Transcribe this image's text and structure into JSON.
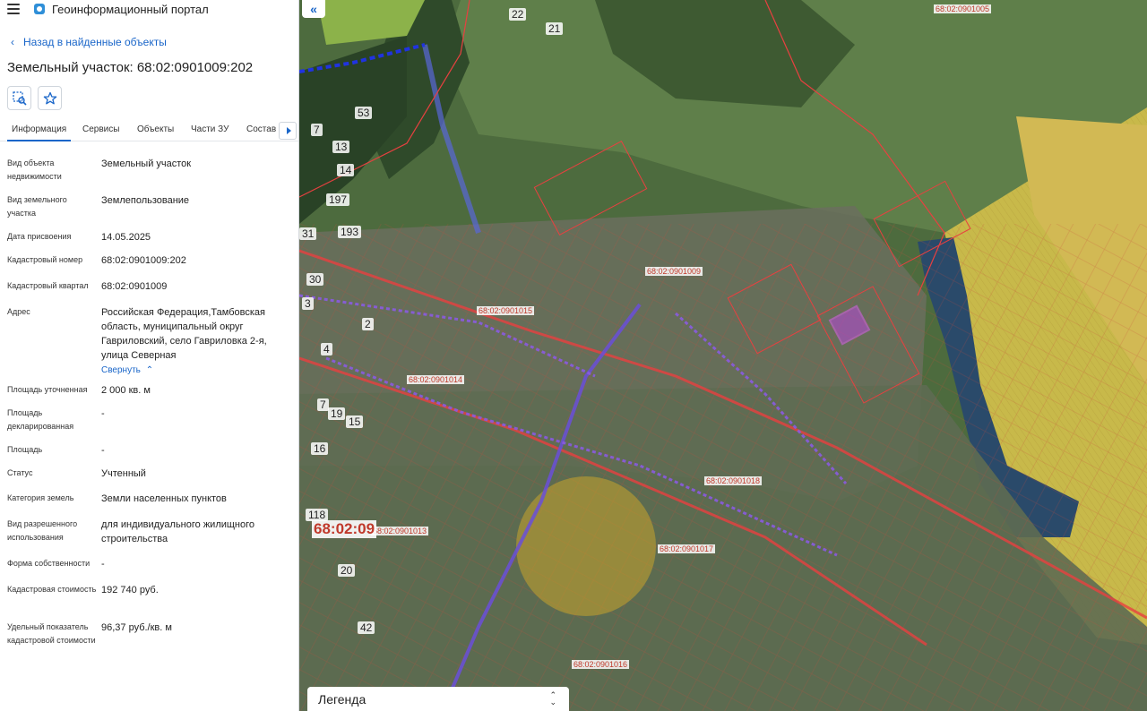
{
  "app": {
    "title": "Геоинформационный портал"
  },
  "nav": {
    "back_label": "Назад в найденные объекты"
  },
  "object": {
    "title": "Земельный участок: 68:02:0901009:202"
  },
  "tabs": [
    {
      "label": "Информация",
      "active": true
    },
    {
      "label": "Сервисы"
    },
    {
      "label": "Объекты"
    },
    {
      "label": "Части ЗУ"
    },
    {
      "label": "Состав"
    }
  ],
  "info": [
    {
      "label": "Вид объекта недвижимости",
      "value": "Земельный участок"
    },
    {
      "label": "Вид земельного участка",
      "value": "Землепользование"
    },
    {
      "label": "Дата присвоения",
      "value": "14.05.2025"
    },
    {
      "label": "Кадастровый номер",
      "value": "68:02:0901009:202"
    },
    {
      "label": "Кадастровый квартал",
      "value": "68:02:0901009"
    },
    {
      "label": "Адрес",
      "value": "Российская Федерация,Тамбовская область, муниципальный округ Гавриловский, село Гавриловка 2-я, улица Северная"
    },
    {
      "label": "Площадь уточненная",
      "value": "2 000 кв. м"
    },
    {
      "label": "Площадь декларированная",
      "value": "-"
    },
    {
      "label": "Площадь",
      "value": "-"
    },
    {
      "label": "Статус",
      "value": "Учтенный"
    },
    {
      "label": "Категория земель",
      "value": "Земли населенных пунктов"
    },
    {
      "label": "Вид разрешенного использования",
      "value": "для индивидуального жилищного строительства"
    },
    {
      "label": "Форма собственности",
      "value": "-"
    },
    {
      "label": "Кадастровая стоимость",
      "value": "192 740 руб."
    },
    {
      "label": "Удельный показатель кадастровой стоимости",
      "value": "96,37 руб./кв. м"
    }
  ],
  "address_toggle": "Свернуть",
  "map": {
    "legend_label": "Легенда",
    "quarter_labels": [
      "68:02:0901005",
      "68:02:0901009",
      "68:02:0901015",
      "68:02:0901014",
      "68:02:0901018",
      "68:02:0901017",
      "68:02:0901016",
      "68:02:0901013"
    ],
    "big_label": "68:02:09",
    "parcel_numbers": [
      "22",
      "21",
      "53",
      "7",
      "13",
      "14",
      "197",
      "193",
      "31",
      "30",
      "3",
      "4",
      "2",
      "7",
      "19",
      "15",
      "16",
      "118",
      "20",
      "42"
    ],
    "colors": {
      "accent": "#1a66c9",
      "boundary": "#e03b3b",
      "field": "#c8b94a",
      "water": "#2a4a6a",
      "forest": "#2f4a2a"
    }
  }
}
